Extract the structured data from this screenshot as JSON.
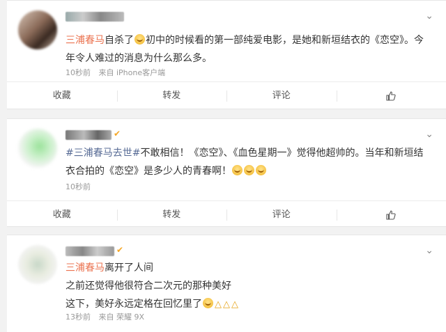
{
  "posts": [
    {
      "mention": "三浦春马",
      "text_main": "自杀了",
      "text_rest": "初中的时候看的第一部纯爱电影，是她和新垣结衣的《恋空》。今年令人难过的消息为什么那么多。",
      "time": "10秒前",
      "source": "来自 iPhone客户端",
      "actions": [
        "收藏",
        "转发",
        "评论"
      ]
    },
    {
      "topic": "#三浦春马去世#",
      "text_main": "不敢相信！《恋空》、《血色星期一》觉得他超帅的。当年和新垣结衣合拍的《恋空》是多少人的青春啊！",
      "time": "10秒前",
      "actions": [
        "收藏",
        "转发",
        "评论"
      ]
    },
    {
      "mention": "三浦春马",
      "line1": "离开了人间",
      "line2": "之前还觉得他很符合二次元的那种美好",
      "line3": "这下，美好永远定格在回忆里了",
      "time": "13秒前",
      "source": "来自 荣耀 9X"
    }
  ],
  "icons": {
    "chevron": "chevron-down-icon",
    "like": "thumbs-up-icon",
    "emoji": "crying-face-emoji",
    "pray": "praying-hands-emoji"
  },
  "colors": {
    "mention": "#eb7350",
    "topic": "#576b95",
    "background": "#f2f2f2"
  }
}
